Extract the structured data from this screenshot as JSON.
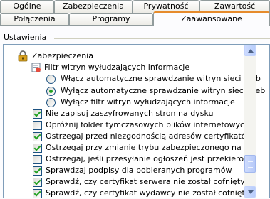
{
  "tabs_top": [
    "Ogólne",
    "Zabezpieczenia",
    "Prywatność",
    "Zawartość"
  ],
  "tabs_bottom": [
    "Połączenia",
    "Programy",
    "Zaawansowane"
  ],
  "settings_label": "Ustawienia",
  "tree": {
    "security_header": "Zabezpieczenia",
    "filter_header": "Filtr witryn wyłudzających informacje",
    "radios": [
      {
        "label": "Włącz automatyczne sprawdzanie witryn sieci Web",
        "checked": false
      },
      {
        "label": "Wyłącz automatyczne sprawdzanie witryn sieci Web",
        "checked": true
      },
      {
        "label": "Wyłącz filtr witryn wyłudzających informacje",
        "checked": false
      }
    ],
    "checks": [
      {
        "label": "Nie zapisuj zaszyfrowanych stron na dysku",
        "checked": true
      },
      {
        "label": "Opróżnij folder tymczasowych plików internetowych podcz",
        "checked": false
      },
      {
        "label": "Ostrzegaj przed niezgodnością adresów certyfikatów*",
        "checked": true
      },
      {
        "label": "Ostrzegaj przy zmianie trybu zabezpieczonego na niezabe",
        "checked": true
      },
      {
        "label": "Ostrzegaj, jeśli przesyłanie ogłoszeń jest przekierowywan",
        "checked": false
      },
      {
        "label": "Sprawdzaj podpisy dla pobieranych programów",
        "checked": true
      },
      {
        "label": "Sprawdź, czy certyfikat serwera nie został cofnięty*",
        "checked": true
      },
      {
        "label": "Sprawdź, czy certyfikat wydawcy nie został cofnięty",
        "checked": true
      }
    ]
  },
  "colors": {
    "accent_tab": "#e68b2c",
    "check": "#21a121",
    "lock": "#d8a020"
  }
}
